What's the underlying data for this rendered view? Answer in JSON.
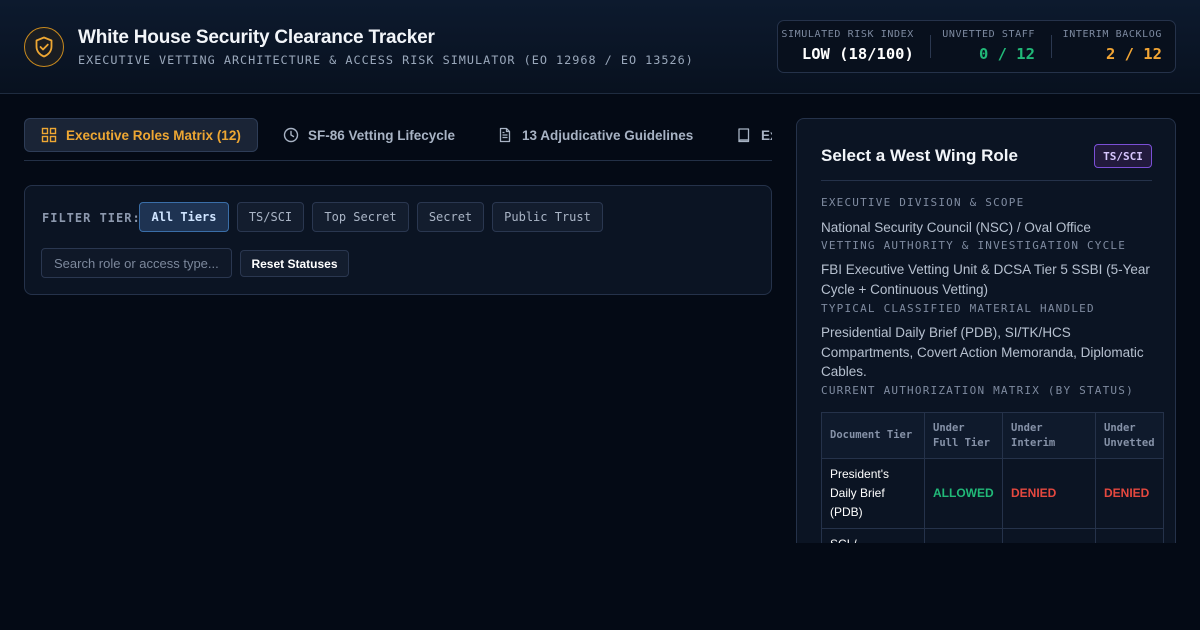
{
  "app": {
    "title": "White House Security Clearance Tracker",
    "subtitle": "EXECUTIVE VETTING ARCHITECTURE & ACCESS RISK SIMULATOR (EO 12968 / EO 13526)"
  },
  "stats": [
    {
      "label": "SIMULATED RISK INDEX",
      "value": "LOW (18/100)",
      "color": "#ffffff"
    },
    {
      "label": "UNVETTED STAFF",
      "value": "0 / 12",
      "color": "#21b978"
    },
    {
      "label": "INTERIM BACKLOG",
      "value": "2 / 12",
      "color": "#f2a534"
    }
  ],
  "tabs": [
    {
      "label": "Executive Roles Matrix (12)",
      "icon": "grid-icon",
      "active": true
    },
    {
      "label": "SF-86 Vetting Lifecycle",
      "icon": "clock-icon",
      "active": false
    },
    {
      "label": "13 Adjudicative Guidelines",
      "icon": "document-icon",
      "active": false
    },
    {
      "label": "Ex",
      "icon": "book-icon",
      "active": false
    }
  ],
  "filter": {
    "label": "FILTER TIER:",
    "chips": [
      {
        "label": "All Tiers",
        "active": true
      },
      {
        "label": "TS/SCI",
        "active": false
      },
      {
        "label": "Top Secret",
        "active": false
      },
      {
        "label": "Secret",
        "active": false
      },
      {
        "label": "Public Trust",
        "active": false
      }
    ],
    "search_placeholder": "Search role or access type...",
    "reset_label": "Reset Statuses"
  },
  "role_panel": {
    "title": "Select a West Wing Role",
    "badge": "TS/SCI",
    "sections": [
      {
        "label": "EXECUTIVE DIVISION & SCOPE",
        "value": "National Security Council (NSC) / Oval Office"
      },
      {
        "label": "VETTING AUTHORITY & INVESTIGATION CYCLE",
        "value": "FBI Executive Vetting Unit & DCSA Tier 5 SSBI (5-Year Cycle + Continuous Vetting)"
      },
      {
        "label": "TYPICAL CLASSIFIED MATERIAL HANDLED",
        "value": "Presidential Daily Brief (PDB), SI/TK/HCS Compartments, Covert Action Memoranda, Diplomatic Cables."
      },
      {
        "label": "CURRENT AUTHORIZATION MATRIX (BY STATUS)",
        "value": ""
      }
    ],
    "matrix": {
      "headers": [
        "Document Tier",
        "Under Full Tier",
        "Under Interim",
        "Under Unvetted"
      ],
      "rows": [
        {
          "doc": "President's Daily Brief (PDB)",
          "full": "ALLOWED",
          "interim": "DENIED",
          "unvetted": "DENIED"
        },
        {
          "doc": "SCI /",
          "full": "",
          "interim": "",
          "unvetted": ""
        }
      ]
    }
  },
  "colors": {
    "accent": "#eea733",
    "allowed": "#21b978",
    "denied": "#e5483f",
    "badge_purple": "#7b4fd6"
  }
}
